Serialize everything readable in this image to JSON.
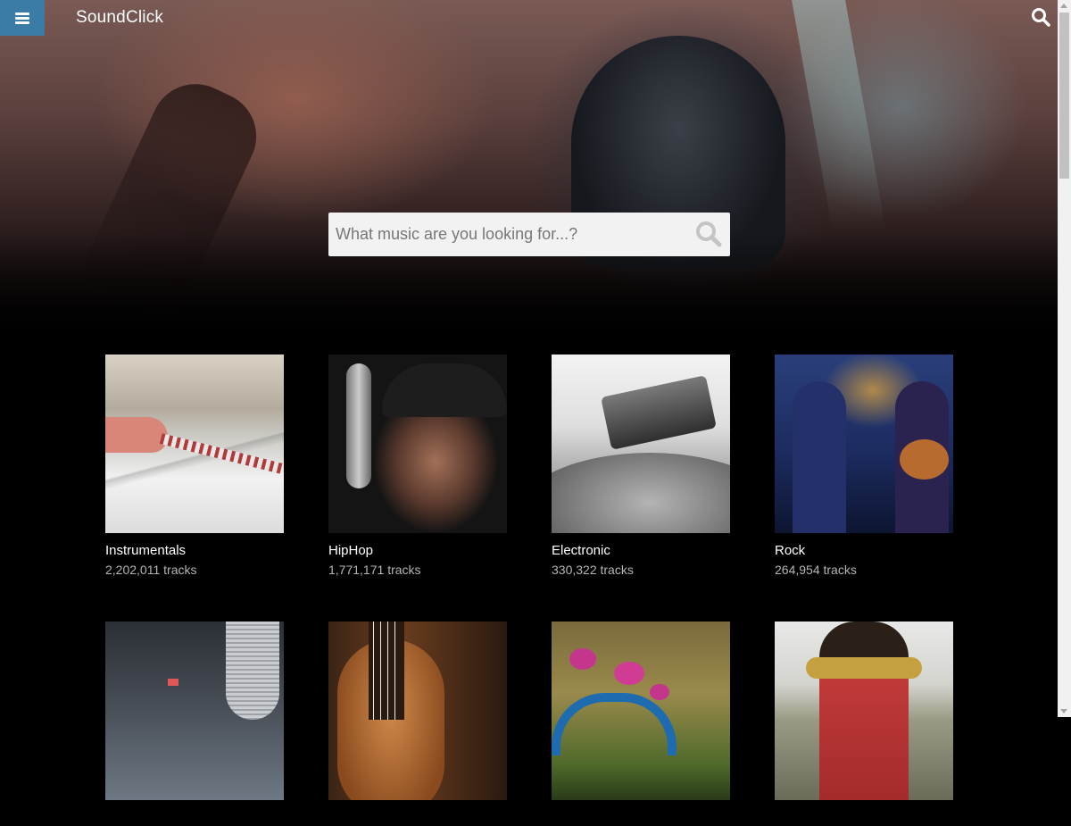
{
  "header": {
    "logo": "SoundClick",
    "menu_icon": "hamburger-menu-icon",
    "search_icon": "search-icon",
    "menu_color": "#3a7ca6"
  },
  "search": {
    "placeholder": "What music are you looking for...?",
    "value": "",
    "submit_icon": "search-icon"
  },
  "genres": [
    {
      "name": "Instrumentals",
      "count": "2,202,011",
      "suffix": "tracks"
    },
    {
      "name": "HipHop",
      "count": "1,771,171",
      "suffix": "tracks"
    },
    {
      "name": "Electronic",
      "count": "330,322",
      "suffix": "tracks"
    },
    {
      "name": "Rock",
      "count": "264,954",
      "suffix": "tracks"
    },
    {
      "name": "",
      "count": "",
      "suffix": ""
    },
    {
      "name": "",
      "count": "",
      "suffix": ""
    },
    {
      "name": "",
      "count": "",
      "suffix": ""
    },
    {
      "name": "",
      "count": "",
      "suffix": ""
    }
  ]
}
